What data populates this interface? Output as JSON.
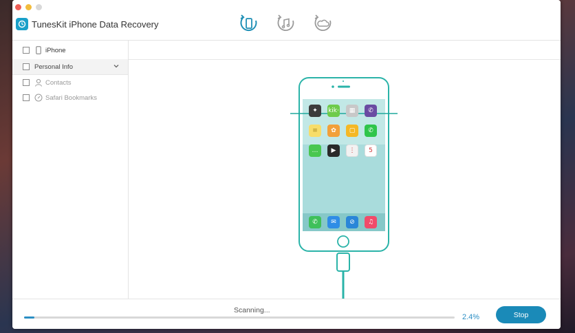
{
  "app": {
    "title": "TunesKit iPhone Data Recovery"
  },
  "toolbar": {
    "modes": [
      {
        "icon": "phone-recover-icon",
        "active": true
      },
      {
        "icon": "itunes-recover-icon",
        "active": false
      },
      {
        "icon": "icloud-recover-icon",
        "active": false
      }
    ]
  },
  "sidebar": {
    "items": [
      {
        "label": "iPhone",
        "icon": "iphone-icon"
      },
      {
        "label": "Personal Info",
        "icon": "chevron-down-icon"
      },
      {
        "label": "Contacts",
        "icon": "contact-icon"
      },
      {
        "label": "Safari Bookmarks",
        "icon": "compass-icon"
      }
    ]
  },
  "phone": {
    "home_apps": [
      {
        "label": "",
        "color": "#3b3b3b",
        "glyph": "✦"
      },
      {
        "label": "kik·",
        "color": "#6ecb4a",
        "glyph": "kik·"
      },
      {
        "label": "",
        "color": "#c8c8c8",
        "glyph": "▦"
      },
      {
        "label": "",
        "color": "#6a4ba2",
        "glyph": "✆"
      },
      {
        "label": "",
        "color": "#f7dd6a",
        "glyph": "≡"
      },
      {
        "label": "",
        "color": "#f2a03a",
        "glyph": "✿"
      },
      {
        "label": "",
        "color": "#f5b825",
        "glyph": "▢"
      },
      {
        "label": "",
        "color": "#2fc54a",
        "glyph": "✆"
      },
      {
        "label": "",
        "color": "#49c74f",
        "glyph": "…"
      },
      {
        "label": "",
        "color": "#2a2a2a",
        "glyph": "▶"
      },
      {
        "label": "",
        "color": "#f2f2f2",
        "glyph": "⋮"
      },
      {
        "label": "5",
        "color": "#ffffff",
        "glyph": "5"
      }
    ],
    "dock_apps": [
      {
        "color": "#3fc05a",
        "glyph": "✆"
      },
      {
        "color": "#2f8de6",
        "glyph": "✉"
      },
      {
        "color": "#2a86d8",
        "glyph": "⊘"
      },
      {
        "color": "#f14b6a",
        "glyph": "♫"
      }
    ]
  },
  "footer": {
    "status": "Scanning...",
    "progress_percent": 2.4,
    "progress_label": "2.4%",
    "stop_label": "Stop"
  },
  "colors": {
    "accent": "#1a8ab8",
    "phone_outline": "#2ab3a8",
    "screen": "#a9dcdc"
  }
}
